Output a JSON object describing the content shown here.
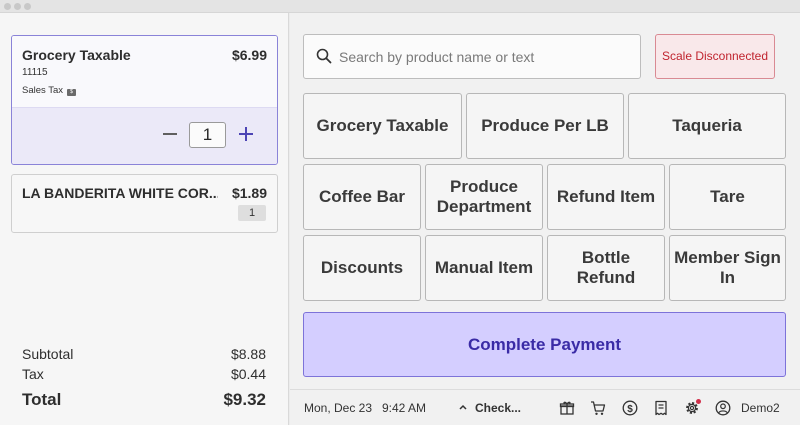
{
  "cart": {
    "items": [
      {
        "name": "Grocery Taxable",
        "price": "$6.99",
        "sku": "11115",
        "tax_label": "Sales Tax",
        "quantity": "1"
      },
      {
        "name": "LA BANDERITA WHITE COR...",
        "price": "$1.89",
        "quantity": "1"
      }
    ]
  },
  "totals": {
    "subtotal_label": "Subtotal",
    "subtotal": "$8.88",
    "tax_label": "Tax",
    "tax": "$0.44",
    "total_label": "Total",
    "total": "$9.32"
  },
  "search": {
    "placeholder": "Search by product name or text"
  },
  "scale_status": "Scale Disconnected",
  "tiles": {
    "grocery_taxable": "Grocery Taxable",
    "produce_per_lb": "Produce Per LB",
    "taqueria": "Taqueria",
    "coffee_bar": "Coffee Bar",
    "produce_department": "Produce Department",
    "refund_item": "Refund Item",
    "tare": "Tare",
    "discounts": "Discounts",
    "manual_item": "Manual Item",
    "bottle_refund": "Bottle Refund",
    "member_sign_in": "Member Sign In"
  },
  "complete_payment": "Complete Payment",
  "statusbar": {
    "date": "Mon, Dec 23",
    "time": "9:42 AM",
    "check_label": "Check...",
    "user": "Demo2",
    "icons": [
      "gift-icon",
      "cart-icon",
      "dollar-icon",
      "receipt-icon",
      "settings-icon",
      "user-icon"
    ],
    "settings_has_notification": true
  },
  "colors": {
    "accent": "#4d45b5",
    "pay_button_bg": "#d4ceff",
    "scale_warning": "#c0242f"
  }
}
